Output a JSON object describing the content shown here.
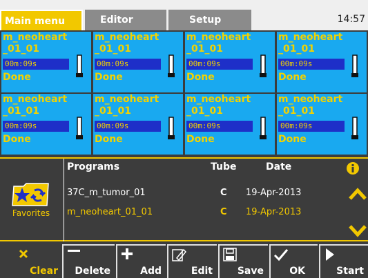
{
  "header": {
    "tabs": [
      {
        "label": "Main menu",
        "active": true
      },
      {
        "label": "Editor",
        "active": false
      },
      {
        "label": "Setup",
        "active": false
      }
    ],
    "time": "14:57"
  },
  "tiles": [
    {
      "name1": "m_neoheart",
      "name2": "_01_01",
      "timer": "00m:09s",
      "status": "Done"
    },
    {
      "name1": "m_neoheart",
      "name2": "_01_01",
      "timer": "00m:09s",
      "status": "Done"
    },
    {
      "name1": "m_neoheart",
      "name2": "_01_01",
      "timer": "00m:09s",
      "status": "Done"
    },
    {
      "name1": "m_neoheart",
      "name2": "_01_01",
      "timer": "00m:09s",
      "status": "Done"
    },
    {
      "name1": "m_neoheart",
      "name2": "_01_01",
      "timer": "00m:09s",
      "status": "Done"
    },
    {
      "name1": "m_neoheart",
      "name2": "_01_01",
      "timer": "00m:09s",
      "status": "Done"
    },
    {
      "name1": "m_neoheart",
      "name2": "_01_01",
      "timer": "00m:09s",
      "status": "Done"
    },
    {
      "name1": "m_neoheart",
      "name2": "_01_01",
      "timer": "00m:09s",
      "status": "Done"
    }
  ],
  "favorites": {
    "label": "Favorites"
  },
  "programs": {
    "columns": {
      "program": "Programs",
      "tube": "Tube",
      "date": "Date"
    },
    "rows": [
      {
        "program": "37C_m_tumor_01",
        "tube": "C",
        "date": "19-Apr-2013",
        "selected": false
      },
      {
        "program": "m_neoheart_01_01",
        "tube": "C",
        "date": "19-Apr-2013",
        "selected": true
      }
    ]
  },
  "toolbar": {
    "clear": "Clear",
    "delete": "Delete",
    "add": "Add",
    "edit": "Edit",
    "save": "Save",
    "ok": "OK",
    "start": "Start"
  },
  "colors": {
    "accent": "#f2c800",
    "tile": "#19a9f0",
    "timer_bg": "#1e2fc8",
    "background": "#3c3c3c"
  },
  "icons": {
    "tube": "tube-icon",
    "favorites": "favorites-folder-icon",
    "info": "info-icon",
    "scroll_up": "chevron-up-icon",
    "scroll_down": "chevron-down-icon"
  }
}
